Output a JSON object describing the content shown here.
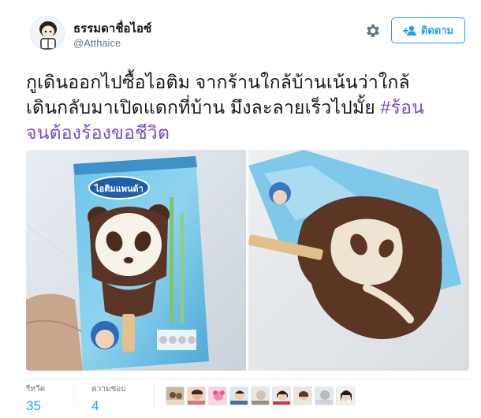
{
  "user": {
    "display_name": "ธรรมดาชื่อไอซ์",
    "handle": "@Atthaice"
  },
  "actions": {
    "follow_label": "ติดตาม",
    "settings_icon": "gear-icon",
    "follow_icon": "person-plus-icon"
  },
  "tweet": {
    "lines": [
      "กูเดินออกไปซื้อไอติม จากร้านใกล้บ้านเน้นว่าใกล้",
      "เดินกลับมาเปิดแดกที่บ้าน มึงละลายเร็วไปมั้ย "
    ],
    "hashtag_part1": "#ร้อน",
    "hashtag_part2": "จนต้องร้องขอชีวิต"
  },
  "stats": {
    "retweets_label": "รีทวีต",
    "retweets_value": "35",
    "likes_label": "ความชอบ",
    "likes_value": "4"
  },
  "media": {
    "package_brand": "ไอติมแพนด้า"
  },
  "colors": {
    "link": "#1da1f2",
    "hashtag": "#7c4bc2",
    "text": "#14171a",
    "muted": "#657786"
  }
}
